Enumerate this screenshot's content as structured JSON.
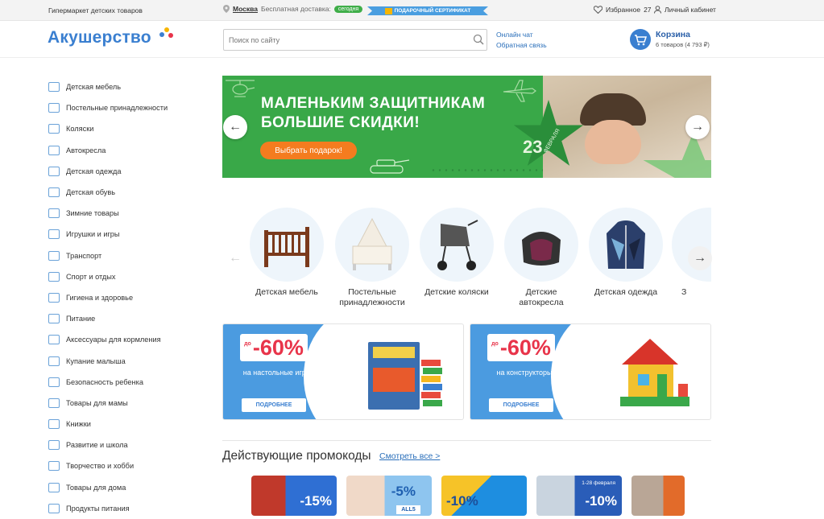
{
  "topbar": {
    "tagline": "Гипермаркет детских товаров",
    "city": "Москва",
    "delivery_text": "Бесплатная доставка:",
    "delivery_badge": "сегодня",
    "certificate": "ПОДАРОЧНЫЙ СЕРТИФИКАТ",
    "favorites_label": "Избранное",
    "favorites_count": "27",
    "account_label": "Личный кабинет"
  },
  "header": {
    "logo": "Акушерство",
    "search_placeholder": "Поиск по сайту",
    "online_chat": "Онлайн чат",
    "feedback": "Обратная связь",
    "cart_title": "Корзина",
    "cart_summary": "6 товаров (4 793 ₽)"
  },
  "sidebar": {
    "items": [
      {
        "label": "Детская мебель",
        "icon": "crib-icon"
      },
      {
        "label": "Постельные принадлежности",
        "icon": "bedding-icon"
      },
      {
        "label": "Коляски",
        "icon": "stroller-icon"
      },
      {
        "label": "Автокресла",
        "icon": "car-seat-icon"
      },
      {
        "label": "Детская одежда",
        "icon": "clothes-icon"
      },
      {
        "label": "Детская обувь",
        "icon": "shoe-icon"
      },
      {
        "label": "Зимние товары",
        "icon": "snowflake-icon"
      },
      {
        "label": "Игрушки и игры",
        "icon": "pyramid-toy-icon"
      },
      {
        "label": "Транспорт",
        "icon": "bicycle-icon"
      },
      {
        "label": "Спорт и отдых",
        "icon": "ball-icon"
      },
      {
        "label": "Гигиена и здоровье",
        "icon": "hygiene-icon"
      },
      {
        "label": "Питание",
        "icon": "food-jar-icon"
      },
      {
        "label": "Аксессуары для кормления",
        "icon": "spoon-icon"
      },
      {
        "label": "Купание малыша",
        "icon": "bath-icon"
      },
      {
        "label": "Безопасность ребенка",
        "icon": "safety-icon"
      },
      {
        "label": "Товары для мамы",
        "icon": "mom-icon"
      },
      {
        "label": "Книжки",
        "icon": "book-icon"
      },
      {
        "label": "Развитие и школа",
        "icon": "school-icon"
      },
      {
        "label": "Творчество и хобби",
        "icon": "palette-icon"
      },
      {
        "label": "Товары для дома",
        "icon": "home-icon"
      },
      {
        "label": "Продукты питания",
        "icon": "groceries-icon"
      }
    ]
  },
  "hero": {
    "line1": "МАЛЕНЬКИМ ЗАЩИТНИКАМ",
    "line2": "БОЛЬШИЕ СКИДКИ!",
    "cta": "Выбрать подарок!",
    "date_number": "23",
    "date_month": "ФЕВРАЛЯ"
  },
  "categories": [
    {
      "label": "Детская мебель"
    },
    {
      "label": "Постельные принадлежности"
    },
    {
      "label": "Детские коляски"
    },
    {
      "label": "Детские автокресла"
    },
    {
      "label": "Детская одежда"
    },
    {
      "label": "З"
    }
  ],
  "promos": [
    {
      "prefix": "до",
      "discount": "-60%",
      "text": "на настольные игры",
      "button": "ПОДРОБНЕЕ"
    },
    {
      "prefix": "до",
      "discount": "-60%",
      "text": "на конструкторы",
      "button": "ПОДРОБНЕЕ"
    }
  ],
  "promocodes": {
    "title": "Действующие промокоды",
    "link": "Смотреть все >",
    "tiles": [
      {
        "pct": "-15%",
        "color": "#2f6fd3"
      },
      {
        "pct": "-5%",
        "color": "#8ec5ef"
      },
      {
        "pct": "-10%",
        "color": "#1e8ee0"
      },
      {
        "pct": "-10%",
        "color": "#2a5db8"
      },
      {
        "pct": "",
        "color": "#e26b2a"
      }
    ]
  }
}
